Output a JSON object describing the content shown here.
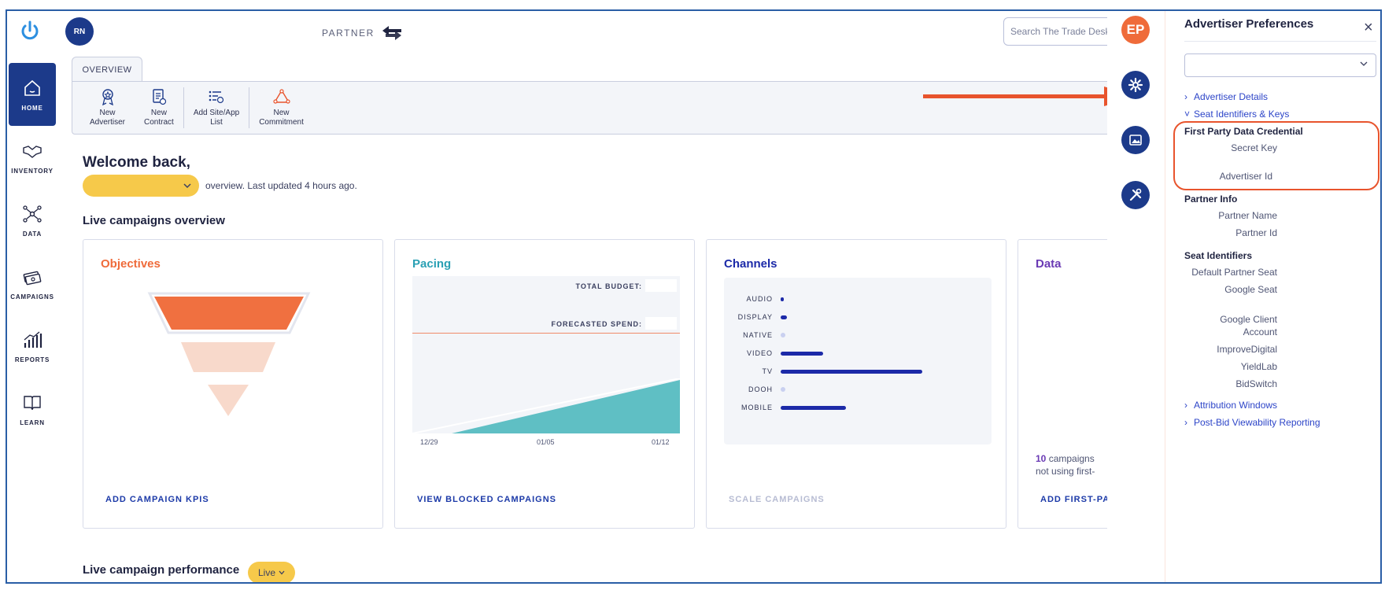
{
  "nav": {
    "items": [
      {
        "label": "HOME",
        "icon": "home-icon"
      },
      {
        "label": "INVENTORY",
        "icon": "handshake-icon"
      },
      {
        "label": "DATA",
        "icon": "network-icon"
      },
      {
        "label": "CAMPAIGNS",
        "icon": "money-icon"
      },
      {
        "label": "REPORTS",
        "icon": "chart-icon"
      },
      {
        "label": "LEARN",
        "icon": "book-icon"
      }
    ]
  },
  "header": {
    "avatar": "RN",
    "partner_label": "PARTNER",
    "search_placeholder": "Search The Trade Desk"
  },
  "toolbar": {
    "tab": "OVERVIEW",
    "tools": [
      {
        "line1": "New",
        "line2": "Advertiser"
      },
      {
        "line1": "New",
        "line2": "Contract"
      },
      {
        "line1": "Add Site/App",
        "line2": "List"
      },
      {
        "line1": "New",
        "line2": "Commitment"
      }
    ]
  },
  "main": {
    "welcome": "Welcome back,",
    "overview_text": "overview.  Last updated 4 hours ago.",
    "live_campaigns_title": "Live campaigns overview",
    "performance_title": "Live campaign performance",
    "live_pill": "Live"
  },
  "cards": {
    "objectives": {
      "title": "Objectives",
      "link": "ADD CAMPAIGN KPIS"
    },
    "pacing": {
      "title": "Pacing",
      "total_budget": "TOTAL BUDGET:",
      "forecasted": "FORECASTED SPEND:",
      "x_ticks": [
        "12/29",
        "01/05",
        "01/12"
      ],
      "link": "VIEW BLOCKED CAMPAIGNS"
    },
    "channels": {
      "title": "Channels",
      "link": "SCALE CAMPAIGNS"
    },
    "data": {
      "title": "Data",
      "count": "10",
      "text1": "campaigns",
      "text2": "not using first-",
      "link": "ADD FIRST-PA"
    }
  },
  "chart_data": {
    "type": "bar",
    "categories": [
      "AUDIO",
      "DISPLAY",
      "NATIVE",
      "VIDEO",
      "TV",
      "DOOH",
      "MOBILE"
    ],
    "values": [
      1,
      2,
      0,
      15,
      50,
      0,
      23
    ],
    "xlim": [
      0,
      50
    ]
  },
  "rail": {
    "avatar": "EP"
  },
  "panel": {
    "title": "Advertiser Preferences",
    "links": {
      "advertiser_details": "Advertiser Details",
      "seat_keys": "Seat Identifiers & Keys",
      "attribution": "Attribution Windows",
      "post_bid": "Post-Bid Viewability Reporting"
    },
    "fpd_title": "First Party Data Credential",
    "fpd_fields": [
      "Secret Key",
      "Advertiser Id"
    ],
    "partner_info_title": "Partner Info",
    "partner_fields": [
      "Partner Name",
      "Partner Id"
    ],
    "seat_title": "Seat Identifiers",
    "seat_fields": [
      "Default Partner Seat",
      "Google Seat",
      "Google Client Account",
      "ImproveDigital",
      "YieldLab",
      "BidSwitch"
    ]
  },
  "colors": {
    "navy": "#1c3a8a",
    "orange": "#ef6b3a",
    "accent_link": "#2d45c8",
    "highlight": "#e8542d",
    "pacing_fill": "#5fbfc4",
    "yellow": "#f6c94a"
  }
}
